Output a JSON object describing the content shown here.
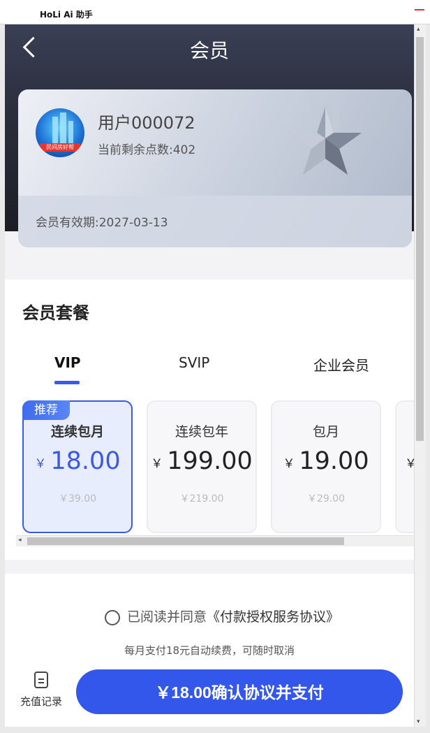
{
  "window": {
    "title": "HoLi Ai 助手"
  },
  "header": {
    "title": "会员"
  },
  "member_card": {
    "username": "用户000072",
    "points_text": "当前剩余点数:402",
    "expiry_text": "会员有效期:2027-03-13",
    "avatar_caption": "民间房好帮"
  },
  "plans_section": {
    "title": "会员套餐",
    "tabs": [
      {
        "label": "VIP",
        "active": true
      },
      {
        "label": "SVIP",
        "active": false
      },
      {
        "label": "企业会员",
        "active": false
      }
    ],
    "currency": "￥",
    "plans": [
      {
        "name": "连续包月",
        "price": "18.00",
        "original": "￥39.00",
        "badge": "推荐",
        "selected": true
      },
      {
        "name": "连续包年",
        "price": "199.00",
        "original": "￥219.00",
        "selected": false
      },
      {
        "name": "包月",
        "price": "19.00",
        "original": "￥29.00",
        "selected": false
      }
    ]
  },
  "footer": {
    "agree_text": "已阅读并同意",
    "agreement_link": "《付款授权服务协议》",
    "note": "每月支付18元自动续费，可随时取消",
    "records_label": "充值记录",
    "pay_button": "￥18.00确认协议并支付"
  },
  "colors": {
    "accent": "#3257ea",
    "header_dark": "#2c2f3f",
    "badge": "#3f6bef"
  }
}
